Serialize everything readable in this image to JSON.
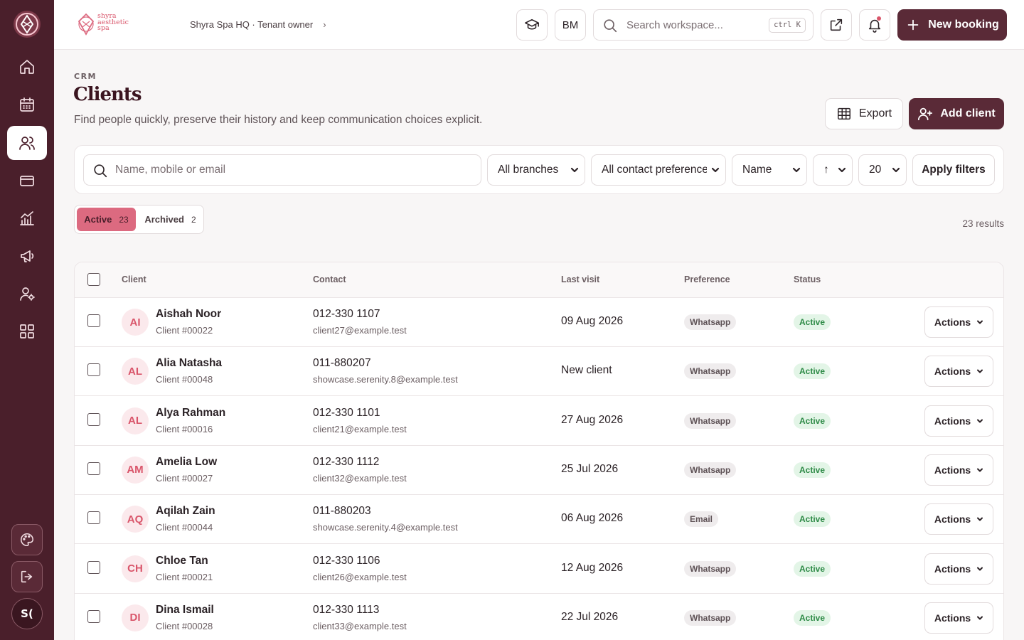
{
  "brand": {
    "logo_text_line1": "shyra",
    "logo_text_line2": "aesthetic",
    "logo_text_line3": "spa",
    "accent": "#5a2a37",
    "sidebar_bg": "#4a1f2b",
    "highlight": "#dc6a80"
  },
  "sidebar": {
    "items": [
      {
        "icon": "home-icon",
        "active": false
      },
      {
        "icon": "calendar-icon",
        "active": false
      },
      {
        "icon": "users-icon",
        "active": true
      },
      {
        "icon": "credit-card-icon",
        "active": false
      },
      {
        "icon": "chart-icon",
        "active": false
      },
      {
        "icon": "megaphone-icon",
        "active": false
      },
      {
        "icon": "user-settings-icon",
        "active": false
      },
      {
        "icon": "apps-grid-icon",
        "active": false
      }
    ],
    "footer": {
      "theme_icon": "palette-icon",
      "logout_icon": "logout-icon",
      "user_initials": "S("
    }
  },
  "topbar": {
    "breadcrumb": "Shyra Spa HQ · Tenant owner",
    "user_initials": "BM",
    "search_placeholder": "Search workspace...",
    "shortcut": "ctrl K",
    "new_booking_label": "New booking"
  },
  "header": {
    "eyebrow": "CRM",
    "title": "Clients",
    "subtitle": "Find people quickly, preserve their history and keep communication choices explicit.",
    "export_label": "Export",
    "add_client_label": "Add client"
  },
  "filters": {
    "search_placeholder": "Name, mobile or email",
    "branch": "All branches",
    "contact_pref": "All contact preferences",
    "sort_by": "Name",
    "sort_dir": "↑",
    "page_size": "20",
    "apply_label": "Apply filters"
  },
  "tabs": {
    "active_label": "Active",
    "active_count": "23",
    "archived_label": "Archived",
    "archived_count": "2",
    "results": "23 results"
  },
  "table": {
    "headers": {
      "client": "Client",
      "contact": "Contact",
      "last_visit": "Last visit",
      "preference": "Preference",
      "status": "Status"
    },
    "actions_label": "Actions",
    "rows": [
      {
        "initials": "AI",
        "name": "Aishah Noor",
        "id": "Client #00022",
        "phone": "012-330 1107",
        "email": "client27@example.test",
        "last_visit": "09 Aug 2026",
        "preference": "Whatsapp",
        "status": "Active"
      },
      {
        "initials": "AL",
        "name": "Alia Natasha",
        "id": "Client #00048",
        "phone": "011-880207",
        "email": "showcase.serenity.8@example.test",
        "last_visit": "New client",
        "preference": "Whatsapp",
        "status": "Active"
      },
      {
        "initials": "AL",
        "name": "Alya Rahman",
        "id": "Client #00016",
        "phone": "012-330 1101",
        "email": "client21@example.test",
        "last_visit": "27 Aug 2026",
        "preference": "Whatsapp",
        "status": "Active"
      },
      {
        "initials": "AM",
        "name": "Amelia Low",
        "id": "Client #00027",
        "phone": "012-330 1112",
        "email": "client32@example.test",
        "last_visit": "25 Jul 2026",
        "preference": "Whatsapp",
        "status": "Active"
      },
      {
        "initials": "AQ",
        "name": "Aqilah Zain",
        "id": "Client #00044",
        "phone": "011-880203",
        "email": "showcase.serenity.4@example.test",
        "last_visit": "06 Aug 2026",
        "preference": "Email",
        "status": "Active"
      },
      {
        "initials": "CH",
        "name": "Chloe Tan",
        "id": "Client #00021",
        "phone": "012-330 1106",
        "email": "client26@example.test",
        "last_visit": "12 Aug 2026",
        "preference": "Whatsapp",
        "status": "Active"
      },
      {
        "initials": "DI",
        "name": "Dina Ismail",
        "id": "Client #00028",
        "phone": "012-330 1113",
        "email": "client33@example.test",
        "last_visit": "22 Jul 2026",
        "preference": "Whatsapp",
        "status": "Active"
      }
    ]
  }
}
